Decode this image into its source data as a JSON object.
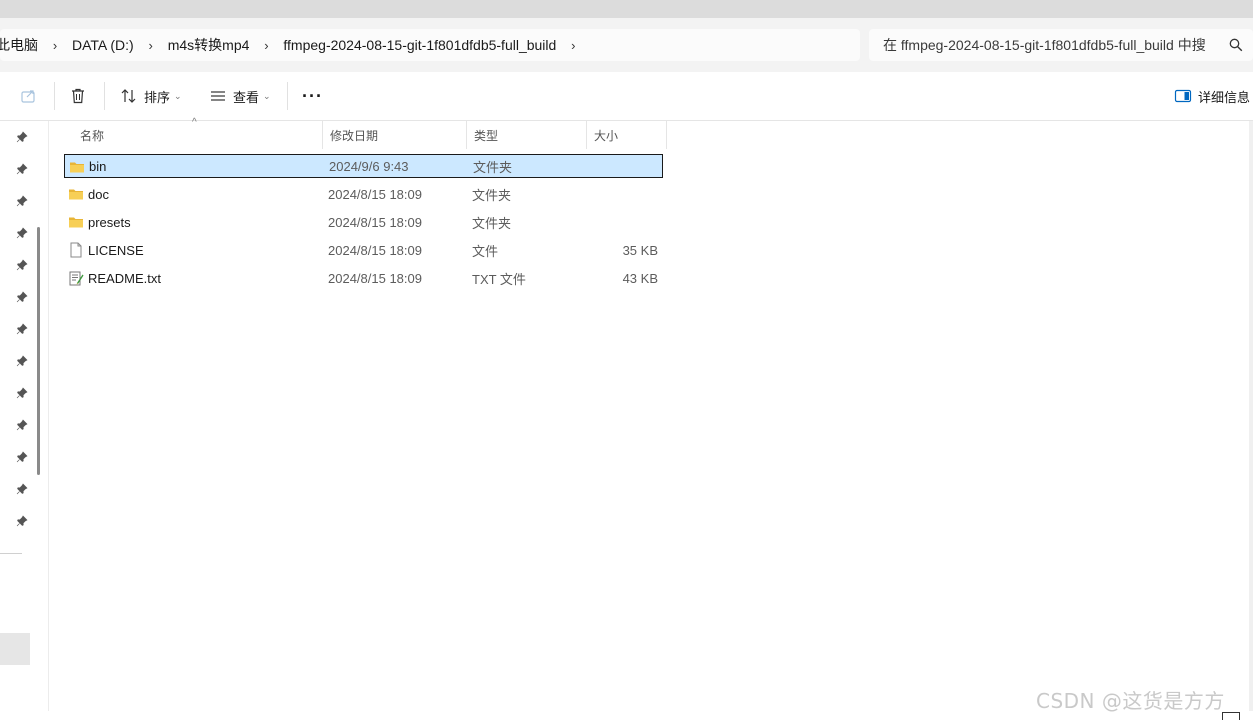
{
  "address_bar": {
    "breadcrumbs": [
      "此电脑",
      "DATA (D:)",
      "m4s转换mp4",
      "ffmpeg-2024-08-15-git-1f801dfdb5-full_build"
    ],
    "search_placeholder": "在 ffmpeg-2024-08-15-git-1f801dfdb5-full_build 中搜"
  },
  "toolbar": {
    "share_icon": "share-icon",
    "delete_icon": "trash-icon",
    "sort_label": "排序",
    "view_label": "查看",
    "more_label": "···",
    "details_label": "详细信息"
  },
  "columns": {
    "name": "名称",
    "date": "修改日期",
    "type": "类型",
    "size": "大小"
  },
  "files": [
    {
      "name": "bin",
      "date": "2024/9/6 9:43",
      "type": "文件夹",
      "size": "",
      "icon": "folder-icon",
      "selected": true
    },
    {
      "name": "doc",
      "date": "2024/8/15 18:09",
      "type": "文件夹",
      "size": "",
      "icon": "folder-icon",
      "selected": false
    },
    {
      "name": "presets",
      "date": "2024/8/15 18:09",
      "type": "文件夹",
      "size": "",
      "icon": "folder-icon",
      "selected": false
    },
    {
      "name": "LICENSE",
      "date": "2024/8/15 18:09",
      "type": "文件",
      "size": "35 KB",
      "icon": "file-icon",
      "selected": false
    },
    {
      "name": "README.txt",
      "date": "2024/8/15 18:09",
      "type": "TXT 文件",
      "size": "43 KB",
      "icon": "text-file-icon",
      "selected": false
    }
  ],
  "watermark": "CSDN @这货是方方",
  "colors": {
    "selection_bg": "#cce8ff",
    "folder_yellow": "#f4c542",
    "accent": "#0067c0"
  }
}
